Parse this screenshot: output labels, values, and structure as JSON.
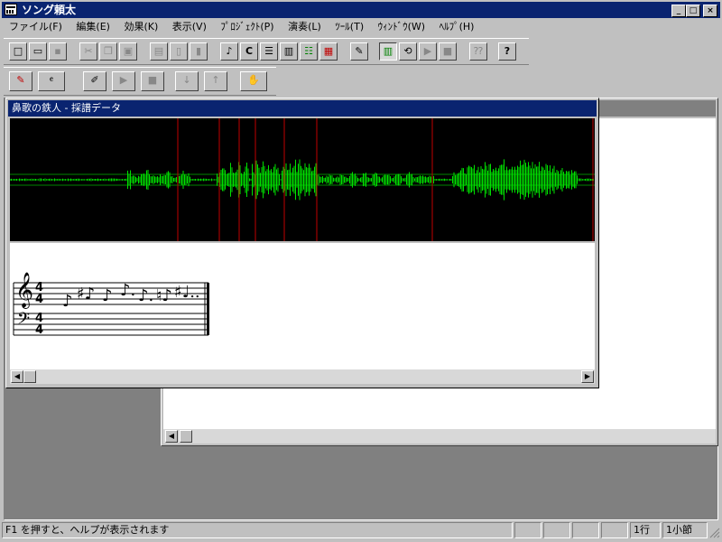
{
  "app": {
    "title": "ソング頼太",
    "window_buttons": {
      "minimize": "_",
      "maximize": "□",
      "close": "×"
    }
  },
  "menu": [
    {
      "label": "ファイル(F)"
    },
    {
      "label": "編集(E)"
    },
    {
      "label": "効果(K)"
    },
    {
      "label": "表示(V)"
    },
    {
      "label": "ﾌﾟﾛｼﾞｪｸﾄ(P)"
    },
    {
      "label": "演奏(L)"
    },
    {
      "label": "ﾂｰﾙ(T)"
    },
    {
      "label": "ｳｨﾝﾄﾞｳ(W)"
    },
    {
      "label": "ﾍﾙﾌﾟ(H)"
    }
  ],
  "toolbar1": {
    "icons": [
      "new-icon",
      "open-icon",
      "save-icon",
      "cut-icon",
      "copy-icon",
      "paste-icon",
      "import-icon",
      "page-icon",
      "export-icon",
      "note-icon",
      "c-icon",
      "list-icon",
      "piano-icon",
      "grid-icon",
      "drum-icon",
      "score-edit-icon",
      "split-view-icon",
      "loop-icon",
      "play-icon",
      "stop-icon",
      "help-topic-icon",
      "whats-this-icon"
    ],
    "glyphs": [
      "□",
      "▭",
      "▪",
      "✂",
      "❐",
      "▣",
      "▤",
      "▯",
      "▮",
      "♪",
      "C",
      "☰",
      "▥",
      "☷",
      "▦",
      "✎",
      "▥",
      "⟲",
      "▶",
      "■",
      "⁇",
      "?"
    ]
  },
  "toolbar2": {
    "icons": [
      "marker-icon",
      "tempo-icon",
      "pencil-icon",
      "play-icon",
      "stop-icon",
      "down-icon",
      "up-icon",
      "hand-icon"
    ],
    "glyphs": [
      "✎",
      "𝄴",
      "✐",
      "▶",
      "■",
      "↓",
      "↑",
      "✋"
    ]
  },
  "child_window": {
    "title": "鼻歌の鉄人 - 採譜データ",
    "waveform_color": "#00e000",
    "marker_color": "#c00000",
    "score": {
      "time_signature_top": "4",
      "time_signature_bottom": "4",
      "treble_clef": "𝄞",
      "bass_clef": "𝄢",
      "notes": [
        "♪",
        "♯♪",
        "♪",
        "♪.",
        "♪.",
        "♮♪",
        "♯♩.."
      ]
    }
  },
  "status": {
    "message": "F1 を押すと、ヘルプが表示されます",
    "line": "1行",
    "measure": "1小節"
  }
}
